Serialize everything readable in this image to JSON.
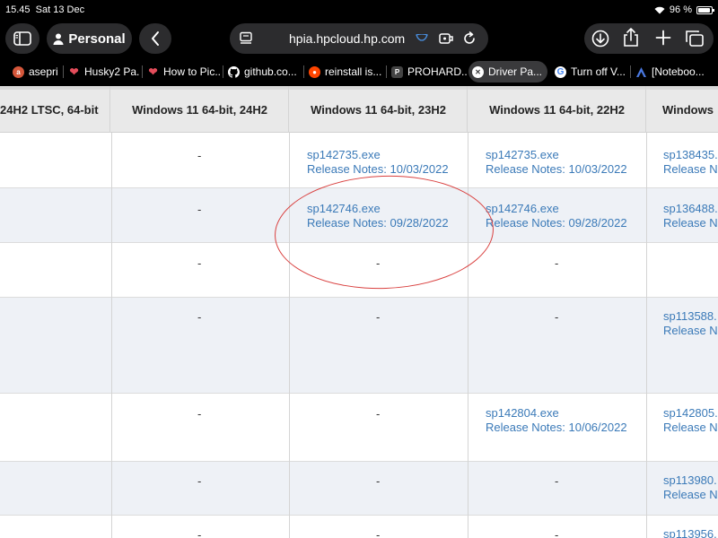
{
  "status": {
    "time": "15.45",
    "date": "Sat 13 Dec",
    "battery": "96 %"
  },
  "toolbar": {
    "profile_label": "Personal",
    "url": "hpia.hpcloud.hp.com"
  },
  "tabs": [
    {
      "label": "asepri",
      "favicon": "aseprite-icon",
      "color": "#d5573b"
    },
    {
      "label": "Husky2 Pa...",
      "favicon": "heart-icon",
      "color": "#e44d5b"
    },
    {
      "label": "How to Pic...",
      "favicon": "heart-icon",
      "color": "#e44d5b"
    },
    {
      "label": "github.co...",
      "favicon": "github-icon",
      "color": "#ffffff"
    },
    {
      "label": "reinstall is...",
      "favicon": "reddit-icon",
      "color": "#ff4500"
    },
    {
      "label": "PROHARD...",
      "favicon": "p-icon",
      "color": "#555555"
    },
    {
      "label": "Driver Pa...",
      "favicon": "close-icon",
      "color": "#ffffff",
      "active": true
    },
    {
      "label": "Turn off V...",
      "favicon": "google-icon",
      "color": "#4285f4"
    },
    {
      "label": "[Noteboo...",
      "favicon": "notebook-icon",
      "color": "#4a78e0"
    }
  ],
  "table": {
    "headers": [
      "24H2 LTSC, 64-bit",
      "Windows 11 64-bit, 24H2",
      "Windows 11 64-bit, 23H2",
      "Windows 11 64-bit, 22H2",
      "Windows"
    ],
    "rows": [
      {
        "c2": "-",
        "c3": [
          "sp142735.exe",
          "Release Notes: 10/03/2022"
        ],
        "c4": [
          "sp142735.exe",
          "Release Notes: 10/03/2022"
        ],
        "c5": [
          "sp138435.",
          "Release N"
        ]
      },
      {
        "c2": "-",
        "c3": [
          "sp142746.exe",
          "Release Notes: 09/28/2022"
        ],
        "c4": [
          "sp142746.exe",
          "Release Notes: 09/28/2022"
        ],
        "c5": [
          "sp136488.",
          "Release N"
        ]
      },
      {
        "c2": "-",
        "c3": "-",
        "c4": "-",
        "c5": ""
      },
      {
        "c2": "-",
        "c3": "-",
        "c4": "-",
        "c5": [
          "sp113588.",
          "Release N"
        ]
      },
      {
        "c2": "-",
        "c3": "-",
        "c4": [
          "sp142804.exe",
          "Release Notes: 10/06/2022"
        ],
        "c5": [
          "sp142805.",
          "Release N"
        ]
      },
      {
        "c2": "-",
        "c3": "-",
        "c4": "-",
        "c5": [
          "sp113980.",
          "Release N"
        ]
      },
      {
        "c2": "-",
        "c3": "-",
        "c4": "-",
        "c5": [
          "sp113956.",
          ""
        ]
      }
    ]
  }
}
